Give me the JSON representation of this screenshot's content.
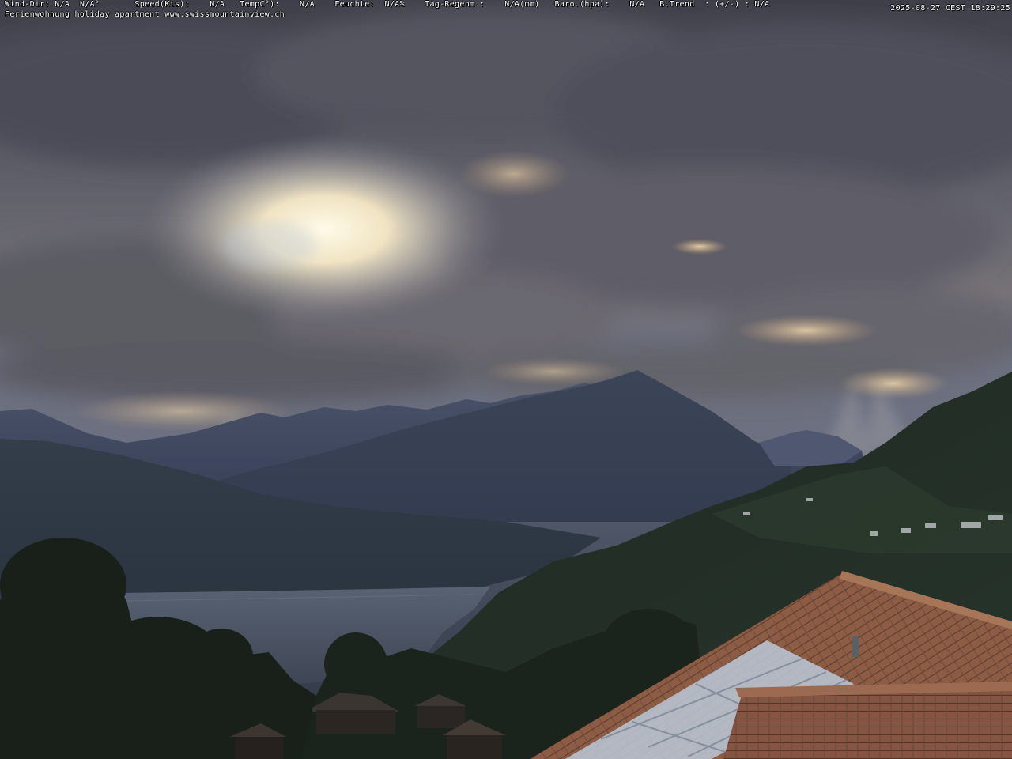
{
  "overlay": {
    "weather": {
      "wind_dir_label": "Wind-Dir:",
      "wind_dir_value": "N/A",
      "wind_dir_deg": "N/A°",
      "speed_label": "Speed(Kts):",
      "speed_value": "N/A",
      "temp_label": "TempC°):",
      "temp_value": "N/A",
      "humidity_label": "Feuchte:",
      "humidity_value": "N/A%",
      "rain_label": "Tag-Regenm.:",
      "rain_value": "N/A(mm)",
      "baro_label": "Baro.(hpa):",
      "baro_value": "N/A",
      "trend_label": "B.Trend",
      "trend_sep": ": (+/-) :",
      "trend_value": "N/A"
    },
    "caption": "Ferienwohnung holiday apartment www.swissmountainview.ch",
    "timestamp": "2025-08-27 CEST 18:29:25"
  },
  "colors": {
    "sky_cloud": "#5a5a66",
    "sun_glow": "#fff6d8",
    "mountain_far": "#4b5468",
    "mountain_peak": "#3a4356",
    "lake": "#4a5363",
    "forest": "#1d2620",
    "roof": "#8a5a44",
    "solar_panel": "#b7c2cf"
  }
}
